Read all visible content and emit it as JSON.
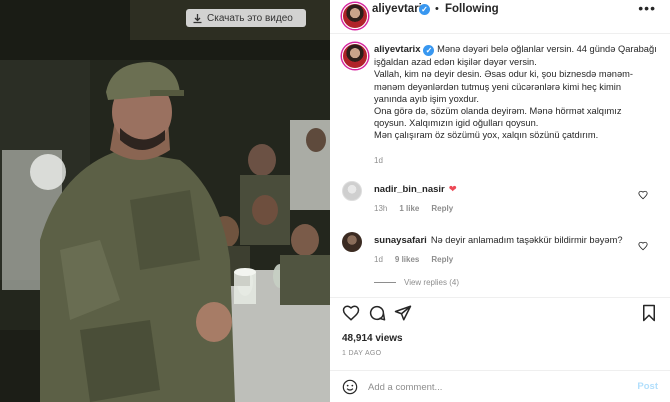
{
  "video": {
    "download_label": "Скачать это видео"
  },
  "header": {
    "username": "aliyevtarix",
    "verified_mark": "✓",
    "separator": "•",
    "follow_status": "Following",
    "more_icon": "more-horizontal-icon"
  },
  "caption": {
    "username": "aliyevtarix",
    "lines": [
      "Mənə dəyəri belə oğlanlar versin. 44 gündə Qarabağı",
      "işğaldan azad edən kişilər dəyər versin.",
      "Vallah, kim nə deyir desin. Əsas odur ki, şou biznesdə mənəm-",
      "mənəm deyənlərdən tutmuş yeni cücərənlərə kimi heç kimin",
      "yanında ayıb işim yoxdur.",
      "Ona görə də, sözüm olanda deyirəm. Mənə hörmət xalqımız",
      "qoysun. Xalqımızın igid oğulları qoysun.",
      "Mən çalışıram öz sözümü yox, xalqın sözünü çatdırım."
    ],
    "age": "1d"
  },
  "comments": [
    {
      "username": "nadir_bin_nasir",
      "text": "❤",
      "age": "13h",
      "likes": "1 like",
      "reply": "Reply"
    },
    {
      "username": "sunaysafari",
      "text": "Nə deyir anlamadım taşəkkür bildirmir bəyəm?",
      "age": "1d",
      "likes": "9 likes",
      "reply": "Reply",
      "view_replies": "View replies (4)"
    }
  ],
  "stats": {
    "views": "48,914 views",
    "posted": "1 DAY AGO"
  },
  "add_comment": {
    "placeholder": "Add a comment...",
    "post_label": "Post"
  },
  "colors": {
    "verified": "#3897f0",
    "link": "#b2dffc",
    "heart": "#ed4956",
    "muted": "#8e8e8e"
  }
}
